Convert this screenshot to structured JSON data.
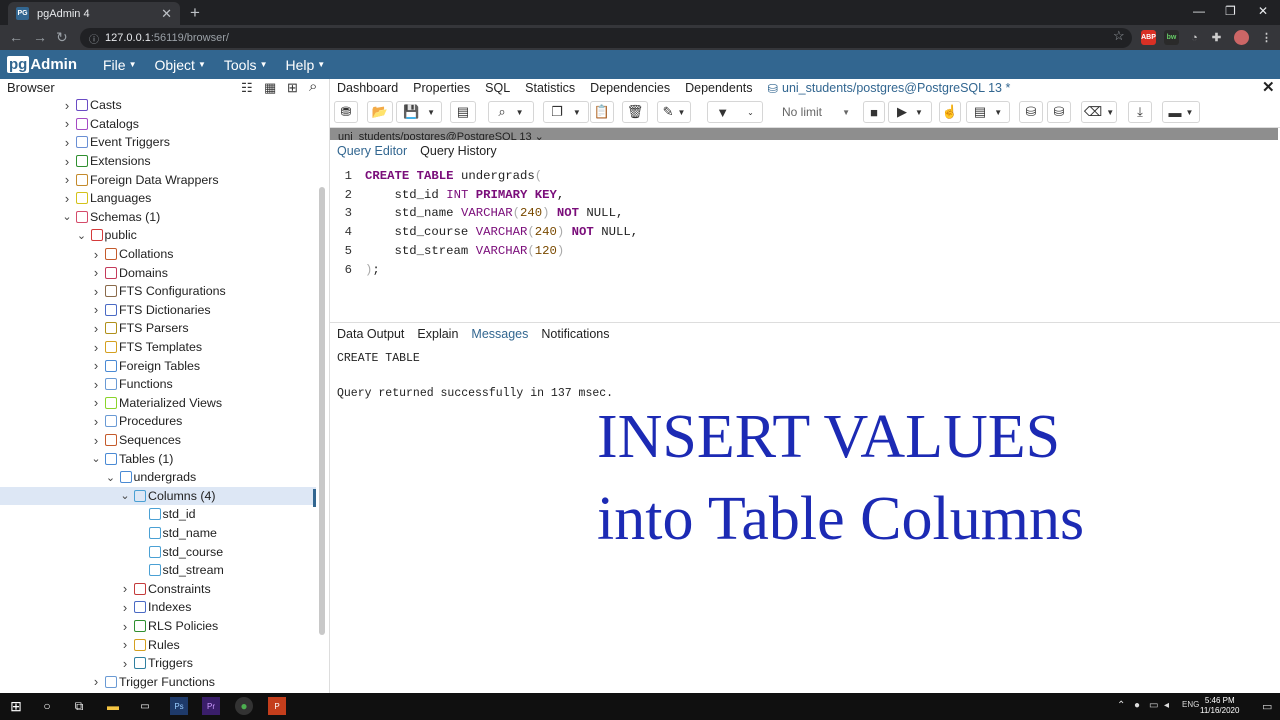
{
  "browser": {
    "tab_title": "pgAdmin 4",
    "tab_favicon": "PG",
    "url_host": "127.0.0.1",
    "url_path": ":56119/browser/"
  },
  "app": {
    "logo_pg": "pg",
    "logo_text": "Admin",
    "menu": [
      "File",
      "Object",
      "Tools",
      "Help"
    ]
  },
  "left_panel": {
    "title": "Browser",
    "tree": [
      {
        "label": "Casts",
        "depth": 0,
        "expander": "collapsed",
        "icon": "casts-icon",
        "color": "#6a4bc4"
      },
      {
        "label": "Catalogs",
        "depth": 0,
        "expander": "collapsed",
        "icon": "catalogs-icon",
        "color": "#a44bc4"
      },
      {
        "label": "Event Triggers",
        "depth": 0,
        "expander": "collapsed",
        "icon": "event-triggers-icon",
        "color": "#6a8fd4"
      },
      {
        "label": "Extensions",
        "depth": 0,
        "expander": "collapsed",
        "icon": "extensions-icon",
        "color": "#2f8f2f"
      },
      {
        "label": "Foreign Data Wrappers",
        "depth": 0,
        "expander": "collapsed",
        "icon": "fdw-icon",
        "color": "#c48a2b"
      },
      {
        "label": "Languages",
        "depth": 0,
        "expander": "collapsed",
        "icon": "languages-icon",
        "color": "#d4c21a"
      },
      {
        "label": "Schemas (1)",
        "depth": 0,
        "expander": "expanded",
        "icon": "schemas-icon",
        "color": "#d44b6a"
      },
      {
        "label": "public",
        "depth": 1,
        "expander": "expanded",
        "icon": "schema-icon",
        "color": "#d43a3a"
      },
      {
        "label": "Collations",
        "depth": 2,
        "expander": "collapsed",
        "icon": "collations-icon",
        "color": "#c45a2b"
      },
      {
        "label": "Domains",
        "depth": 2,
        "expander": "collapsed",
        "icon": "domains-icon",
        "color": "#c43a5a"
      },
      {
        "label": "FTS Configurations",
        "depth": 2,
        "expander": "collapsed",
        "icon": "fts-config-icon",
        "color": "#8a6a4a"
      },
      {
        "label": "FTS Dictionaries",
        "depth": 2,
        "expander": "collapsed",
        "icon": "fts-dict-icon",
        "color": "#4a6ac4"
      },
      {
        "label": "FTS Parsers",
        "depth": 2,
        "expander": "collapsed",
        "icon": "fts-parser-icon",
        "color": "#b0901a"
      },
      {
        "label": "FTS Templates",
        "depth": 2,
        "expander": "collapsed",
        "icon": "fts-template-icon",
        "color": "#d4a020"
      },
      {
        "label": "Foreign Tables",
        "depth": 2,
        "expander": "collapsed",
        "icon": "foreign-tables-icon",
        "color": "#4a8ad4"
      },
      {
        "label": "Functions",
        "depth": 2,
        "expander": "collapsed",
        "icon": "functions-icon",
        "color": "#6a9ad4"
      },
      {
        "label": "Materialized Views",
        "depth": 2,
        "expander": "collapsed",
        "icon": "mat-views-icon",
        "color": "#8ad42a"
      },
      {
        "label": "Procedures",
        "depth": 2,
        "expander": "collapsed",
        "icon": "procedures-icon",
        "color": "#6a9ad4"
      },
      {
        "label": "Sequences",
        "depth": 2,
        "expander": "collapsed",
        "icon": "sequences-icon",
        "color": "#c45a2b"
      },
      {
        "label": "Tables (1)",
        "depth": 2,
        "expander": "expanded",
        "icon": "tables-icon",
        "color": "#4a8ad4"
      },
      {
        "label": "undergrads",
        "depth": 3,
        "expander": "expanded",
        "icon": "table-icon",
        "color": "#4a8ad4"
      },
      {
        "label": "Columns (4)",
        "depth": 4,
        "expander": "expanded",
        "icon": "columns-icon",
        "color": "#4aa0d4",
        "selected": true
      },
      {
        "label": "std_id",
        "depth": 5,
        "expander": "none",
        "icon": "column-icon",
        "color": "#4aa0d4"
      },
      {
        "label": "std_name",
        "depth": 5,
        "expander": "none",
        "icon": "column-icon",
        "color": "#4aa0d4"
      },
      {
        "label": "std_course",
        "depth": 5,
        "expander": "none",
        "icon": "column-icon",
        "color": "#4aa0d4"
      },
      {
        "label": "std_stream",
        "depth": 5,
        "expander": "none",
        "icon": "column-icon",
        "color": "#4aa0d4"
      },
      {
        "label": "Constraints",
        "depth": 4,
        "expander": "collapsed",
        "icon": "constraints-icon",
        "color": "#c43a3a"
      },
      {
        "label": "Indexes",
        "depth": 4,
        "expander": "collapsed",
        "icon": "indexes-icon",
        "color": "#4a6ac4"
      },
      {
        "label": "RLS Policies",
        "depth": 4,
        "expander": "collapsed",
        "icon": "rls-icon",
        "color": "#2f8f2f"
      },
      {
        "label": "Rules",
        "depth": 4,
        "expander": "collapsed",
        "icon": "rules-icon",
        "color": "#d4a020"
      },
      {
        "label": "Triggers",
        "depth": 4,
        "expander": "collapsed",
        "icon": "triggers-icon",
        "color": "#2f7fa0"
      },
      {
        "label": "Trigger Functions",
        "depth": 2,
        "expander": "collapsed",
        "icon": "trigger-functions-icon",
        "color": "#6a9ad4"
      }
    ]
  },
  "right_panel": {
    "tabs": [
      "Dashboard",
      "Properties",
      "SQL",
      "Statistics",
      "Dependencies",
      "Dependents"
    ],
    "query_tab": "uni_students/postgres@PostgreSQL 13 *",
    "connection_bar": "uni_students/postgres@PostgreSQL 13 ⌄",
    "limit": "No limit",
    "editor_tabs": [
      "Query Editor",
      "Query History"
    ],
    "editor_lines": [
      {
        "no": "1",
        "tokens": [
          [
            "kw",
            "CREATE TABLE"
          ],
          [
            "pl",
            " undergrads"
          ],
          [
            "pu",
            "("
          ]
        ]
      },
      {
        "no": "2",
        "tokens": [
          [
            "pl",
            "    std_id "
          ],
          [
            "ty",
            "INT"
          ],
          [
            "pl",
            " "
          ],
          [
            "kw",
            "PRIMARY KEY"
          ],
          [
            "pl",
            ","
          ]
        ]
      },
      {
        "no": "3",
        "tokens": [
          [
            "pl",
            "    std_name "
          ],
          [
            "ty",
            "VARCHAR"
          ],
          [
            "pu",
            "("
          ],
          [
            "nu",
            "240"
          ],
          [
            "pu",
            ")"
          ],
          [
            "pl",
            " "
          ],
          [
            "kw",
            "NOT"
          ],
          [
            "pl",
            " NULL,"
          ]
        ]
      },
      {
        "no": "4",
        "tokens": [
          [
            "pl",
            "    std_course "
          ],
          [
            "ty",
            "VARCHAR"
          ],
          [
            "pu",
            "("
          ],
          [
            "nu",
            "240"
          ],
          [
            "pu",
            ")"
          ],
          [
            "pl",
            " "
          ],
          [
            "kw",
            "NOT"
          ],
          [
            "pl",
            " NULL,"
          ]
        ]
      },
      {
        "no": "5",
        "tokens": [
          [
            "pl",
            "    std_stream "
          ],
          [
            "ty",
            "VARCHAR"
          ],
          [
            "pu",
            "("
          ],
          [
            "nu",
            "120"
          ],
          [
            "pu",
            ")"
          ]
        ]
      },
      {
        "no": "6",
        "tokens": [
          [
            "pu",
            ")"
          ],
          [
            "pl",
            ";"
          ]
        ]
      }
    ],
    "output_tabs": [
      "Data Output",
      "Explain",
      "Messages",
      "Notifications"
    ],
    "active_output_tab": "Messages",
    "messages": [
      "CREATE TABLE",
      "Query returned successfully in 137 msec."
    ]
  },
  "overlay": {
    "line1": "INSERT VALUES",
    "line2": "into Table Columns"
  },
  "taskbar": {
    "lang": "ENG",
    "time": "5:46 PM",
    "date": "11/16/2020"
  },
  "colors": {
    "brand": "#326690",
    "overlay_text": "#1c2ab4",
    "selected_row": "#dde7f5"
  }
}
